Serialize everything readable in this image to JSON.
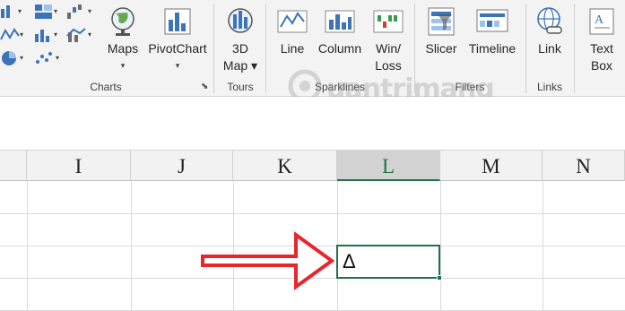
{
  "ribbon": {
    "groups": {
      "charts": "Charts",
      "tours": "Tours",
      "sparklines": "Sparklines",
      "filters": "Filters",
      "links": "Links"
    },
    "buttons": {
      "maps": "Maps",
      "pivotchart": "PivotChart",
      "map3d_line1": "3D",
      "map3d_line2": "Map",
      "line": "Line",
      "column": "Column",
      "winloss_line1": "Win/",
      "winloss_line2": "Loss",
      "slicer": "Slicer",
      "timeline": "Timeline",
      "link": "Link",
      "textbox_line1": "Text",
      "textbox_line2": "Box"
    }
  },
  "watermark": "uantrimang",
  "columns": [
    "I",
    "J",
    "K",
    "L",
    "M",
    "N"
  ],
  "selected_column": "L",
  "active_cell": {
    "column": "L",
    "value": "Δ"
  },
  "colors": {
    "accent": "#217346",
    "arrow": "#e8252b"
  }
}
